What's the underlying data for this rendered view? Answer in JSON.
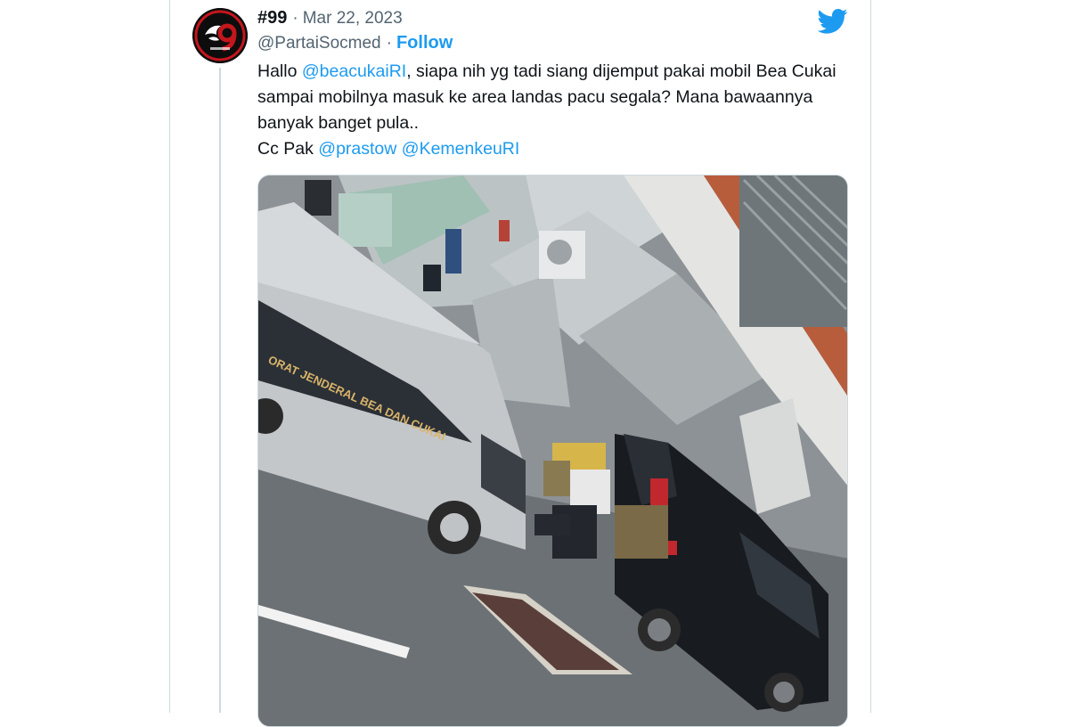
{
  "tweet": {
    "display_name": "#99",
    "separator": "·",
    "date": "Mar 22, 2023",
    "handle": "@PartaiSocmed",
    "follow_label": "Follow",
    "text_parts": {
      "p1": "Hallo ",
      "m1": "@beacukaiRI",
      "p2": ", siapa nih yg tadi siang dijemput pakai mobil Bea Cukai sampai mobilnya masuk ke area landas pacu segala? Mana bawaannya banyak banget pula..",
      "p3": "Cc Pak ",
      "m2": "@prastow",
      "p4": " ",
      "m3": "@KemenkeuRI"
    },
    "media": {
      "van_text": "ORAT JENDERAL BEA DAN CUKAI"
    }
  },
  "icons": {
    "avatar": "avatar-logo",
    "brand": "twitter-bird-icon"
  },
  "colors": {
    "link": "#1d9bf0",
    "text": "#0f1419",
    "muted": "#536471"
  }
}
